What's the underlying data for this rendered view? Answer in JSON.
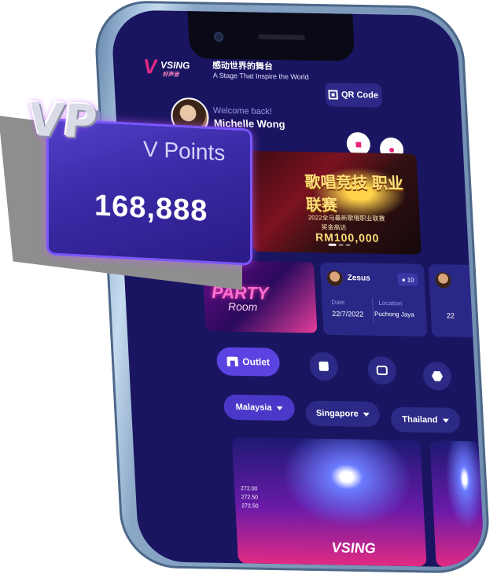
{
  "app": {
    "brand": "VSING",
    "brand_cn": "好声音",
    "tagline_cn": "感动世界的舞台",
    "tagline_en": "A Stage That Inspire the World",
    "qr_label": "QR Code"
  },
  "user": {
    "welcome": "Welcome back!",
    "name": "Michelle Wong"
  },
  "banner": {
    "title": "歌唱竞技 职业联赛",
    "subtitle": "2022全马最新歌唱职业联赛",
    "prize": "RM100,000",
    "prize_cn": "奖金高达"
  },
  "party_room": {
    "line1": "PARTY",
    "line2": "Room"
  },
  "event": {
    "host": "Zesus",
    "count": "10",
    "date_label": "Date",
    "date_value": "22/7/2022",
    "location_label": "Location",
    "location_value": "Puchong Jaya"
  },
  "event2": {
    "date_value": "22"
  },
  "actions": {
    "outlet_label": "Outlet"
  },
  "countries": [
    {
      "label": "Malaysia"
    },
    {
      "label": "Singapore"
    },
    {
      "label": "Thailand"
    }
  ],
  "venue": {
    "labels": "272.00\n272.50\n272.50",
    "logo": "VSING"
  },
  "vpoints": {
    "badge": "VP",
    "label": "V Points",
    "value": "168,888"
  },
  "colors": {
    "screen_bg": "#1a1560",
    "accent": "#5a43e0",
    "pink": "#e12a83"
  }
}
